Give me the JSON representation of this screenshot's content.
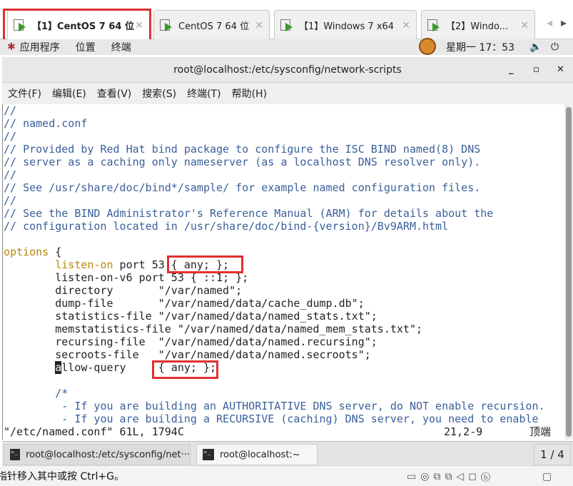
{
  "tabs": [
    {
      "label": "【1】CentOS 7 64 位",
      "active": true
    },
    {
      "label": "CentOS 7 64 位"
    },
    {
      "label": "【1】Windows 7 x64"
    },
    {
      "label": "【2】Windo..."
    }
  ],
  "gnome": {
    "apps": "应用程序",
    "places": "位置",
    "terminal": "终端",
    "clock": "星期一 17：53"
  },
  "window": {
    "title": "root@localhost:/etc/sysconfig/network-scripts"
  },
  "menu": [
    "文件(F)",
    "编辑(E)",
    "查看(V)",
    "搜索(S)",
    "终端(T)",
    "帮助(H)"
  ],
  "editor": {
    "lines": [
      "//",
      "// named.conf",
      "//",
      "// Provided by Red Hat bind package to configure the ISC BIND named(8) DNS",
      "// server as a caching only nameserver (as a localhost DNS resolver only).",
      "//",
      "// See /usr/share/doc/bind*/sample/ for example named configuration files.",
      "//",
      "// See the BIND Administrator's Reference Manual (ARM) for details about the",
      "// configuration located in /usr/share/doc/bind-{version}/Bv9ARM.html",
      "",
      "options {",
      "        listen-on port 53 { any; };",
      "        listen-on-v6 port 53 { ::1; };",
      "        directory       \"/var/named\";",
      "        dump-file       \"/var/named/data/cache_dump.db\";",
      "        statistics-file \"/var/named/data/named_stats.txt\";",
      "        memstatistics-file \"/var/named/data/named_mem_stats.txt\";",
      "        recursing-file  \"/var/named/data/named.recursing\";",
      "        secroots-file   \"/var/named/data/named.secroots\";",
      "        allow-query     { any; };",
      "",
      "        /*",
      "         - If you are building an AUTHORITATIVE DNS server, do NOT enable recursion.",
      "         - If you are building a RECURSIVE (caching) DNS server, you need to enable"
    ],
    "status_file": "\"/etc/named.conf\" 61L, 1794C",
    "status_pos": "21,2-9",
    "status_scroll": "顶端"
  },
  "taskbar": {
    "items": [
      "root@localhost:/etc/sysconfig/net···",
      "root@localhost:~"
    ],
    "workspace": "1 / 4"
  },
  "hint": "指针移入其中或按 Ctrl+G。",
  "colors": {
    "comment": "#3a5f9a",
    "keyword": "#b8860b",
    "highlight": "#e03030"
  }
}
